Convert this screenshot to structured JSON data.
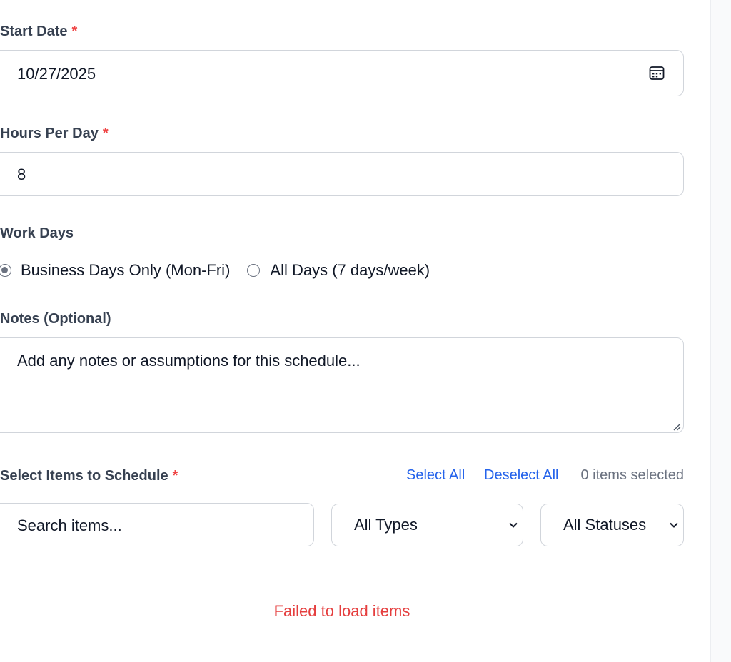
{
  "start_date": {
    "label": "Start Date",
    "required_mark": "*",
    "value": "10/27/2025"
  },
  "hours_per_day": {
    "label": "Hours Per Day",
    "required_mark": "*",
    "value": "8"
  },
  "work_days": {
    "label": "Work Days",
    "options": [
      {
        "label": "Business Days Only (Mon-Fri)",
        "selected": true
      },
      {
        "label": "All Days (7 days/week)",
        "selected": false
      }
    ]
  },
  "notes": {
    "label": "Notes (Optional)",
    "placeholder": "Add any notes or assumptions for this schedule..."
  },
  "items": {
    "label": "Select Items to Schedule",
    "required_mark": "*",
    "select_all": "Select All",
    "deselect_all": "Deselect All",
    "selected_count": "0 items selected",
    "search_placeholder": "Search items...",
    "type_filter": "All Types",
    "status_filter": "All Statuses",
    "error": "Failed to load items"
  },
  "colors": {
    "link": "#2563eb",
    "required": "#ef4444",
    "error": "#e53e3e"
  },
  "icons": {
    "date_picker": "calendar-icon",
    "dropdown": "chevron-down-icon",
    "textarea_resize": "resize-handle-icon"
  }
}
